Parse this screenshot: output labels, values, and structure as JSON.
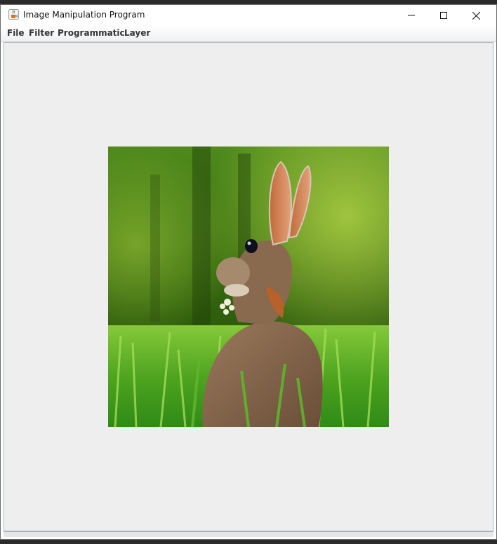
{
  "window": {
    "title": "Image Manipulation Program",
    "app_icon": "java-coffee-cup-icon"
  },
  "window_controls": {
    "minimize_icon": "minimize-icon",
    "maximize_icon": "maximize-icon",
    "close_icon": "close-icon"
  },
  "menubar": {
    "items": [
      {
        "label": "File"
      },
      {
        "label": "Filter"
      },
      {
        "label": "Programmatic"
      },
      {
        "label": "Layer"
      }
    ]
  },
  "canvas": {
    "background": "#eeeeee",
    "image_subject": "rabbit-in-grass-photo"
  }
}
